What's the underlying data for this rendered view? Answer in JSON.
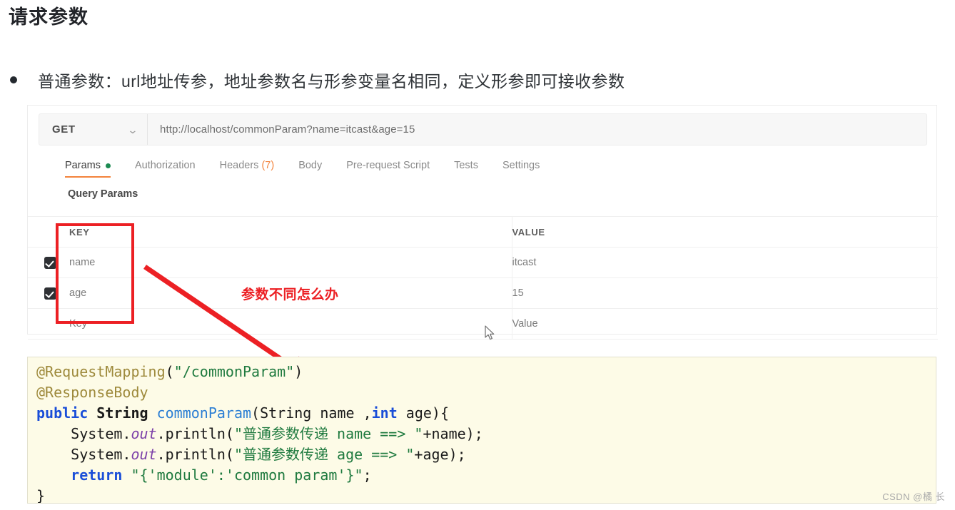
{
  "page": {
    "title": "请求参数",
    "bullet": "普通参数：url地址传参，地址参数名与形参变量名相同，定义形参即可接收参数",
    "watermark": "CSDN @橘 长"
  },
  "postman": {
    "method": "GET",
    "method_chevron": "chevron-down-icon",
    "url": "http://localhost/commonParam?name=itcast&age=15",
    "tabs": [
      {
        "label": "Params",
        "active": true,
        "dot": true
      },
      {
        "label": "Authorization",
        "active": false,
        "dot": false
      },
      {
        "label": "Headers",
        "count": "(7)",
        "active": false,
        "dot": false
      },
      {
        "label": "Body",
        "active": false,
        "dot": false
      },
      {
        "label": "Pre-request Script",
        "active": false,
        "dot": false
      },
      {
        "label": "Tests",
        "active": false,
        "dot": false
      },
      {
        "label": "Settings",
        "active": false,
        "dot": false
      }
    ],
    "section_label": "Query Params",
    "table": {
      "headers": {
        "key": "KEY",
        "value": "VALUE"
      },
      "rows": [
        {
          "checked": true,
          "key": "name",
          "value": "itcast",
          "placeholder": false
        },
        {
          "checked": true,
          "key": "age",
          "value": "15",
          "placeholder": false
        },
        {
          "checked": false,
          "key": "Key",
          "value": "Value",
          "placeholder": true
        }
      ]
    }
  },
  "annotations": {
    "note_text": "参数不同怎么办",
    "accent_color": "#ec2024"
  },
  "code": {
    "lines": [
      {
        "segments": [
          {
            "t": "@RequestMapping",
            "c": "anno"
          },
          {
            "t": "(",
            "c": "plain"
          },
          {
            "t": "\"/commonParam\"",
            "c": "str"
          },
          {
            "t": ")",
            "c": "plain"
          }
        ]
      },
      {
        "segments": [
          {
            "t": "@ResponseBody",
            "c": "anno"
          }
        ]
      },
      {
        "segments": [
          {
            "t": "public",
            "c": "kw"
          },
          {
            "t": " ",
            "c": "plain"
          },
          {
            "t": "String",
            "c": "type"
          },
          {
            "t": " ",
            "c": "plain"
          },
          {
            "t": "commonParam",
            "c": "fn"
          },
          {
            "t": "(String name ,",
            "c": "plain"
          },
          {
            "t": "int",
            "c": "kw"
          },
          {
            "t": " age){",
            "c": "plain"
          }
        ]
      },
      {
        "segments": [
          {
            "t": "    System.",
            "c": "plain"
          },
          {
            "t": "out",
            "c": "field"
          },
          {
            "t": ".println(",
            "c": "plain"
          },
          {
            "t": "\"普通参数传递 name ==> \"",
            "c": "str"
          },
          {
            "t": "+name);",
            "c": "plain"
          }
        ]
      },
      {
        "segments": [
          {
            "t": "    System.",
            "c": "plain"
          },
          {
            "t": "out",
            "c": "field"
          },
          {
            "t": ".println(",
            "c": "plain"
          },
          {
            "t": "\"普通参数传递 age ==> \"",
            "c": "str"
          },
          {
            "t": "+age);",
            "c": "plain"
          }
        ]
      },
      {
        "segments": [
          {
            "t": "    ",
            "c": "plain"
          },
          {
            "t": "return",
            "c": "kw"
          },
          {
            "t": " ",
            "c": "plain"
          },
          {
            "t": "\"{'module':'common param'}\"",
            "c": "str"
          },
          {
            "t": ";",
            "c": "plain"
          }
        ]
      },
      {
        "segments": [
          {
            "t": "}",
            "c": "plain"
          }
        ]
      }
    ]
  }
}
